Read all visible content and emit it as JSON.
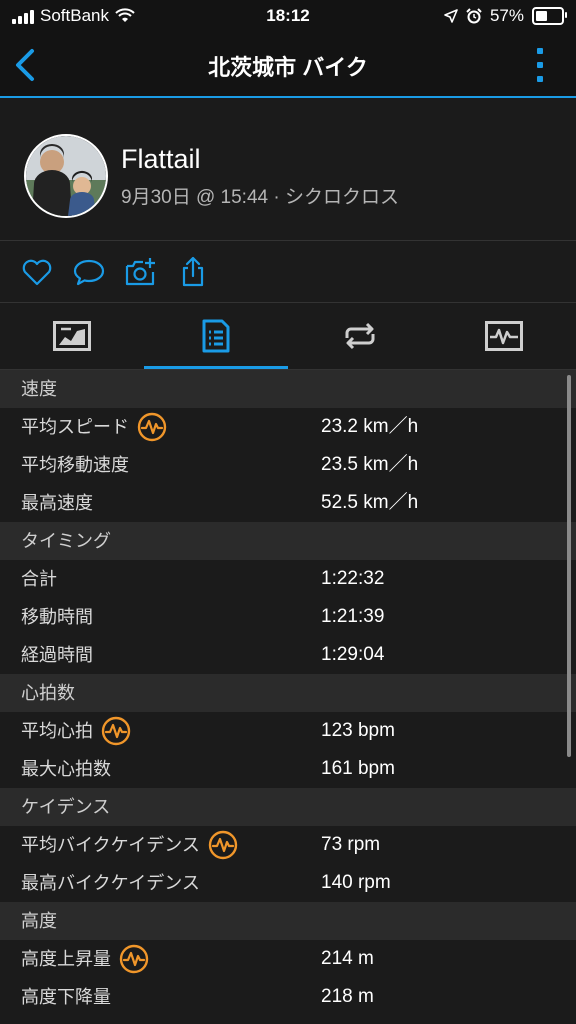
{
  "status_bar": {
    "carrier": "SoftBank",
    "time": "18:12",
    "battery": "57%",
    "battery_level": 0.57
  },
  "nav": {
    "title": "北茨城市 バイク"
  },
  "profile": {
    "name": "Flattail",
    "meta": "9月30日 @ 15:44 · シクロクロス"
  },
  "colors": {
    "accent": "#1a9be6",
    "icon_orange": "#f0962a"
  },
  "sections": [
    {
      "title": "速度",
      "rows": [
        {
          "label": "平均スピード",
          "value": "23.2 km／h",
          "icon": true
        },
        {
          "label": "平均移動速度",
          "value": "23.5 km／h",
          "icon": false
        },
        {
          "label": "最高速度",
          "value": "52.5 km／h",
          "icon": false
        }
      ]
    },
    {
      "title": "タイミング",
      "rows": [
        {
          "label": "合計",
          "value": "1:22:32",
          "icon": false
        },
        {
          "label": "移動時間",
          "value": "1:21:39",
          "icon": false
        },
        {
          "label": "経過時間",
          "value": "1:29:04",
          "icon": false
        }
      ]
    },
    {
      "title": "心拍数",
      "rows": [
        {
          "label": "平均心拍",
          "value": "123 bpm",
          "icon": true
        },
        {
          "label": "最大心拍数",
          "value": "161 bpm",
          "icon": false
        }
      ]
    },
    {
      "title": "ケイデンス",
      "rows": [
        {
          "label": "平均バイクケイデンス",
          "value": "73 rpm",
          "icon": true
        },
        {
          "label": "最高バイクケイデンス",
          "value": "140 rpm",
          "icon": false
        }
      ]
    },
    {
      "title": "高度",
      "rows": [
        {
          "label": "高度上昇量",
          "value": "214 m",
          "icon": true
        },
        {
          "label": "高度下降量",
          "value": "218 m",
          "icon": false
        }
      ]
    }
  ]
}
